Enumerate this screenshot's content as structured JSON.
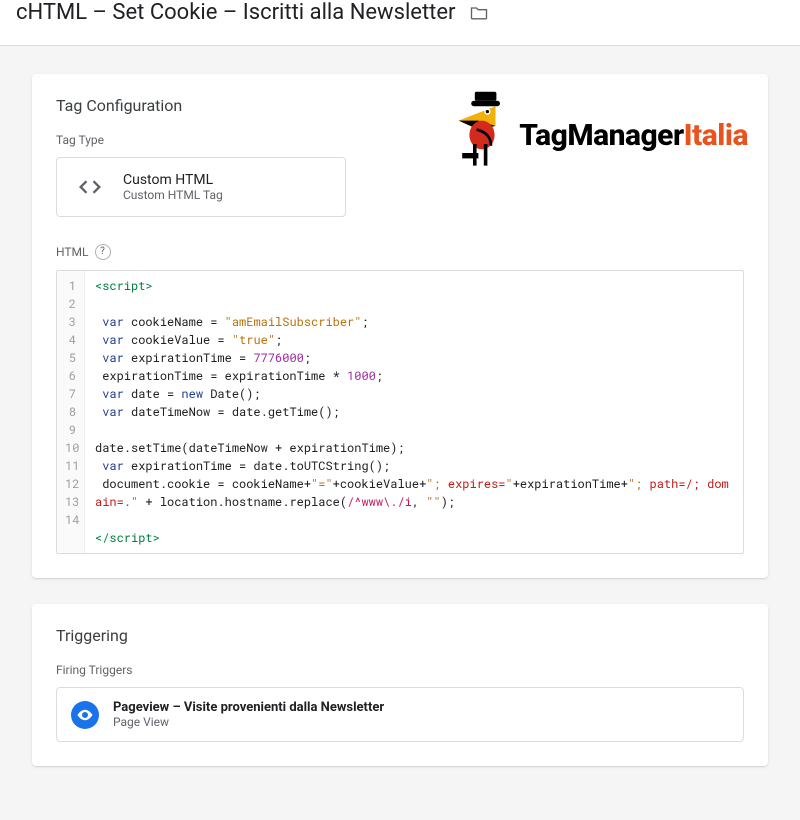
{
  "header": {
    "title": "cHTML – Set Cookie – Iscritti alla Newsletter"
  },
  "brand": {
    "prefix": "TagManager",
    "suffix": "Italia"
  },
  "config": {
    "section_title": "Tag Configuration",
    "tag_type_label": "Tag Type",
    "tag_type_name": "Custom HTML",
    "tag_type_sub": "Custom HTML Tag",
    "html_label": "HTML",
    "code_lines": [
      {
        "n": 1,
        "html": "<span class='tok-tag'>&lt;script&gt;</span>"
      },
      {
        "n": 2,
        "html": ""
      },
      {
        "n": 3,
        "html": " <span class='tok-kw'>var</span> cookieName = <span class='tok-str'>\"amEmailSubscriber\"</span>;"
      },
      {
        "n": 4,
        "html": " <span class='tok-kw'>var</span> cookieValue = <span class='tok-str'>\"true\"</span>;"
      },
      {
        "n": 5,
        "html": " <span class='tok-kw'>var</span> expirationTime = <span class='tok-num'>7776000</span>;"
      },
      {
        "n": 6,
        "html": " expirationTime = expirationTime * <span class='tok-num'>1000</span>;"
      },
      {
        "n": 7,
        "html": " <span class='tok-kw'>var</span> date = <span class='tok-kw'>new</span> Date();"
      },
      {
        "n": 8,
        "html": " <span class='tok-kw'>var</span> dateTimeNow = date.getTime();"
      },
      {
        "n": 9,
        "html": ""
      },
      {
        "n": 10,
        "html": "date.setTime(dateTimeNow + expirationTime);"
      },
      {
        "n": 11,
        "html": " <span class='tok-kw'>var</span> expirationTime = date.toUTCString();"
      },
      {
        "n": 12,
        "html": " document.cookie = cookieName+<span class='tok-str'>\"=\"</span>+cookieValue+<span class='tok-str'>\";</span> <span class='tok-attr'>expires=</span><span class='tok-str'>\"</span>+expirationTime+<span class='tok-str'>\";</span> <span class='tok-attr'>path=/;</span> <span class='tok-attr'>domain=.</span><span class='tok-str'>\"</span> + location.hostname.replace(<span class='tok-regex'>/^www\\./i</span>, <span class='tok-str'>\"\"</span>);"
      },
      {
        "n": 13,
        "html": ""
      },
      {
        "n": 14,
        "html": "<span class='tok-tag'>&lt;/script&gt;</span>"
      }
    ]
  },
  "triggering": {
    "section_title": "Triggering",
    "firing_label": "Firing Triggers",
    "trigger_name": "Pageview – Visite provenienti dalla Newsletter",
    "trigger_type": "Page View"
  }
}
